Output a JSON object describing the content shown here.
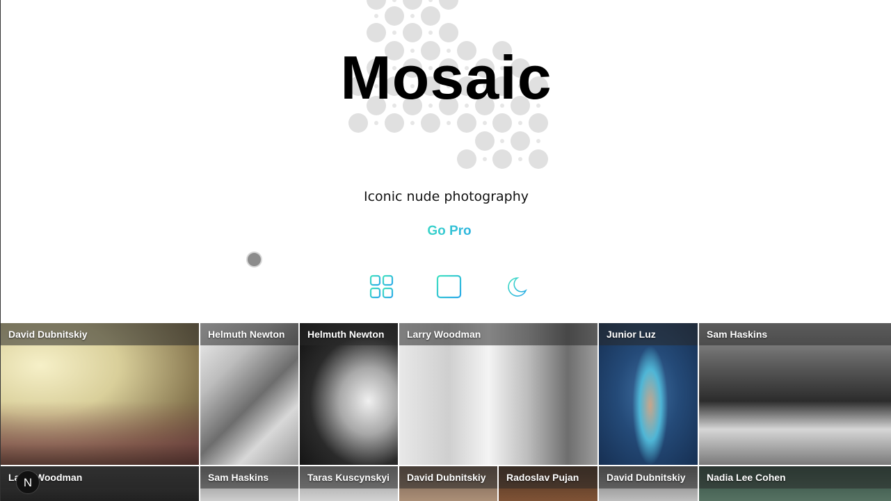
{
  "hero": {
    "title": "Mosaic",
    "subtitle": "Iconic nude photography",
    "cta_label": "Go Pro"
  },
  "view_controls": {
    "icons": [
      "grid-view-icon",
      "masonry-view-icon",
      "dark-mode-moon-icon"
    ],
    "accent_gradient": [
      "#3fe0c0",
      "#29a8e8"
    ]
  },
  "gallery": {
    "row1": [
      {
        "photographer": "David Dubnitskiy"
      },
      {
        "photographer": "Helmuth Newton"
      },
      {
        "photographer": "Helmuth Newton"
      },
      {
        "photographer": "Larry Woodman"
      },
      {
        "photographer": "Junior Luz"
      },
      {
        "photographer": "Sam Haskins"
      }
    ],
    "row2": [
      {
        "photographer": "Larry Woodman"
      },
      {
        "photographer": "Sam Haskins"
      },
      {
        "photographer": "Taras Kuscynskyi"
      },
      {
        "photographer": "David Dubnitskiy"
      },
      {
        "photographer": "Radoslav Pujan"
      },
      {
        "photographer": "David Dubnitskiy"
      },
      {
        "photographer": "Nadia Lee Cohen"
      }
    ]
  },
  "dev_badge": {
    "label": "N"
  }
}
